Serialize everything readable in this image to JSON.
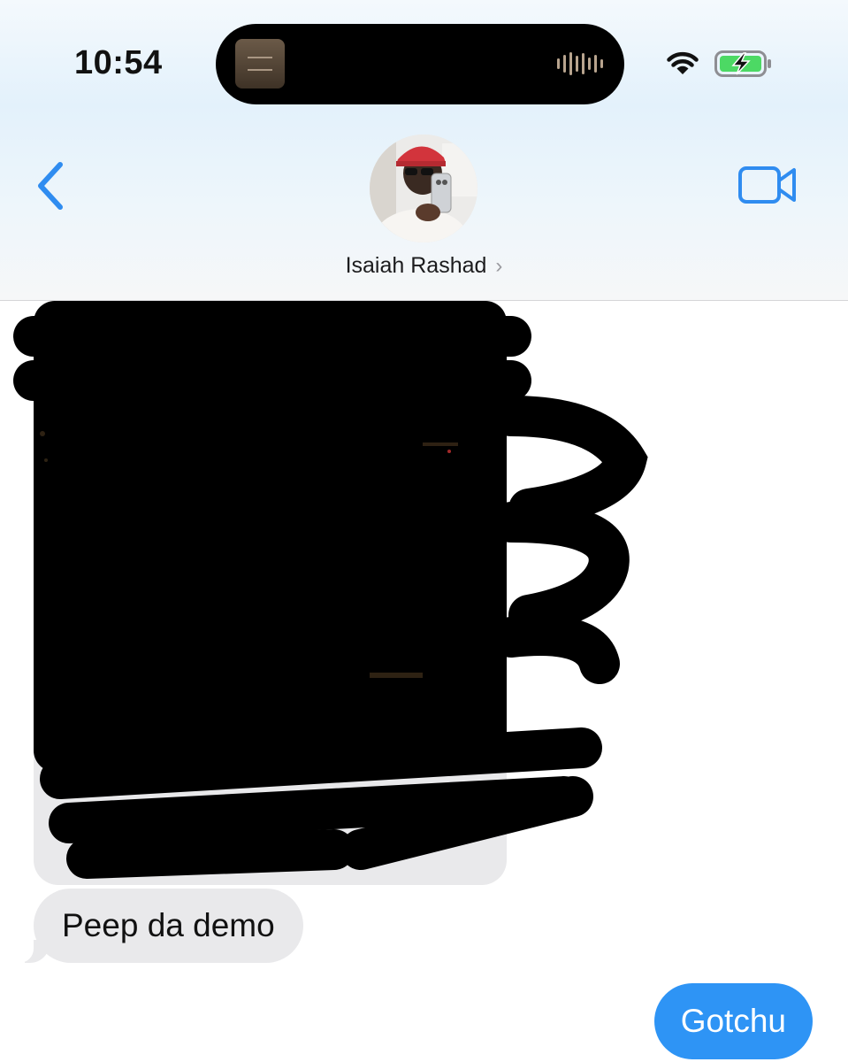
{
  "status_bar": {
    "time": "10:54",
    "icons": [
      "wifi-icon",
      "battery-charging-icon",
      "audio-waveform-icon"
    ]
  },
  "nav": {
    "back_icon": "chevron-left-icon",
    "video_icon": "video-camera-icon",
    "contact_name": "Isaiah Rashad",
    "contact_chevron": "›"
  },
  "messages": [
    {
      "type": "image",
      "direction": "received",
      "content": "redacted-image"
    },
    {
      "type": "text",
      "direction": "received",
      "text": "Peep da demo"
    },
    {
      "type": "text",
      "direction": "sent",
      "text": "Gotchu"
    }
  ],
  "colors": {
    "accent": "#2e94f5",
    "received_bubble": "#e9e9eb",
    "battery_green": "#4cd964"
  }
}
